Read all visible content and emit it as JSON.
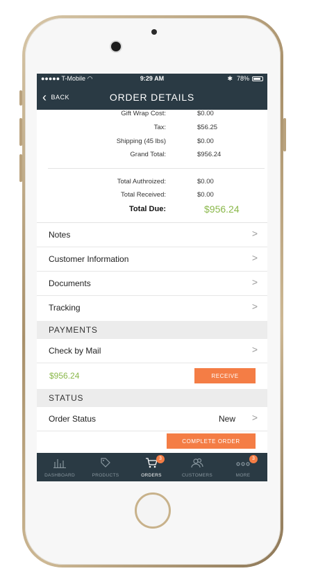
{
  "status_bar": {
    "carrier": "T-Mobile",
    "time": "9:29 AM",
    "battery": "78%"
  },
  "nav": {
    "back_label": "BACK",
    "title": "ORDER DETAILS"
  },
  "summary": {
    "gift_wrap": {
      "label": "Gift Wrap Cost:",
      "value": "$0.00"
    },
    "tax": {
      "label": "Tax:",
      "value": "$56.25"
    },
    "shipping": {
      "label": "Shipping (45 lbs)",
      "value": "$0.00"
    },
    "grand_total": {
      "label": "Grand Total:",
      "value": "$956.24"
    },
    "total_authorized": {
      "label": "Total Authroized:",
      "value": "$0.00"
    },
    "total_received": {
      "label": "Total Received:",
      "value": "$0.00"
    },
    "total_due": {
      "label": "Total Due:",
      "value": "$956.24"
    }
  },
  "menu": {
    "notes": "Notes",
    "customer_information": "Customer Information",
    "documents": "Documents",
    "tracking": "Tracking"
  },
  "payments": {
    "header": "PAYMENTS",
    "method": "Check by Mail",
    "amount": "$956.24",
    "receive_button": "RECEIVE"
  },
  "status": {
    "header": "STATUS",
    "order_status_label": "Order Status",
    "order_status_value": "New",
    "complete_button": "COMPLETE ORDER"
  },
  "tabs": [
    {
      "label": "DASHBOARD",
      "icon": "bar-chart-icon"
    },
    {
      "label": "PRODUCTS",
      "icon": "tag-icon"
    },
    {
      "label": "ORDERS",
      "icon": "cart-icon",
      "badge": "3",
      "active": true
    },
    {
      "label": "CUSTOMERS",
      "icon": "users-icon"
    },
    {
      "label": "MORE",
      "icon": "more-dots-icon",
      "badge": "3"
    }
  ],
  "colors": {
    "nav_bg": "#2a3a44",
    "accent_orange": "#f47d45",
    "accent_green": "#8ab84a",
    "section_bg": "#ececec"
  }
}
